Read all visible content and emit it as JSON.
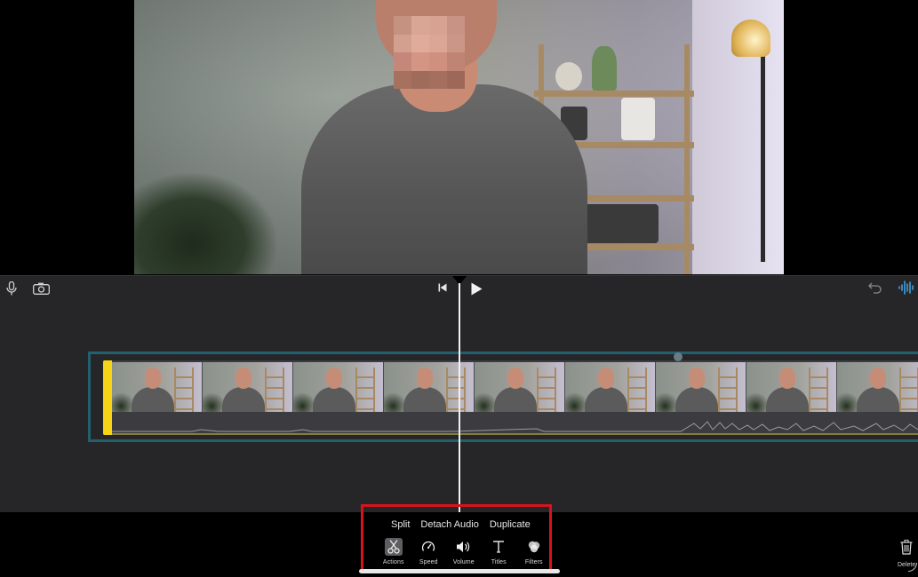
{
  "timeline_toolbar": {
    "mic_icon": "microphone-icon",
    "camera_icon": "camera-icon",
    "skip_back_icon": "skip-to-start-icon",
    "play_icon": "play-icon",
    "undo_icon": "undo-icon",
    "audio_wave_icon": "audio-waveform-icon"
  },
  "clip_actions": {
    "split": "Split",
    "detach_audio": "Detach Audio",
    "duplicate": "Duplicate"
  },
  "tools": [
    {
      "label": "Actions",
      "icon": "scissors-icon",
      "active": true
    },
    {
      "label": "Speed",
      "icon": "speedometer-icon",
      "active": false
    },
    {
      "label": "Volume",
      "icon": "speaker-icon",
      "active": false
    },
    {
      "label": "Titles",
      "icon": "text-icon",
      "active": false
    },
    {
      "label": "Filters",
      "icon": "filters-icon",
      "active": false
    }
  ],
  "delete": {
    "label": "Delete",
    "icon": "trash-icon"
  },
  "colors": {
    "clip_handle": "#f6d416",
    "selection_border": "#23606e",
    "highlight_box": "#d8131b",
    "timeline_bg": "#262629",
    "audio_wave_accent": "#3fa2e0"
  }
}
